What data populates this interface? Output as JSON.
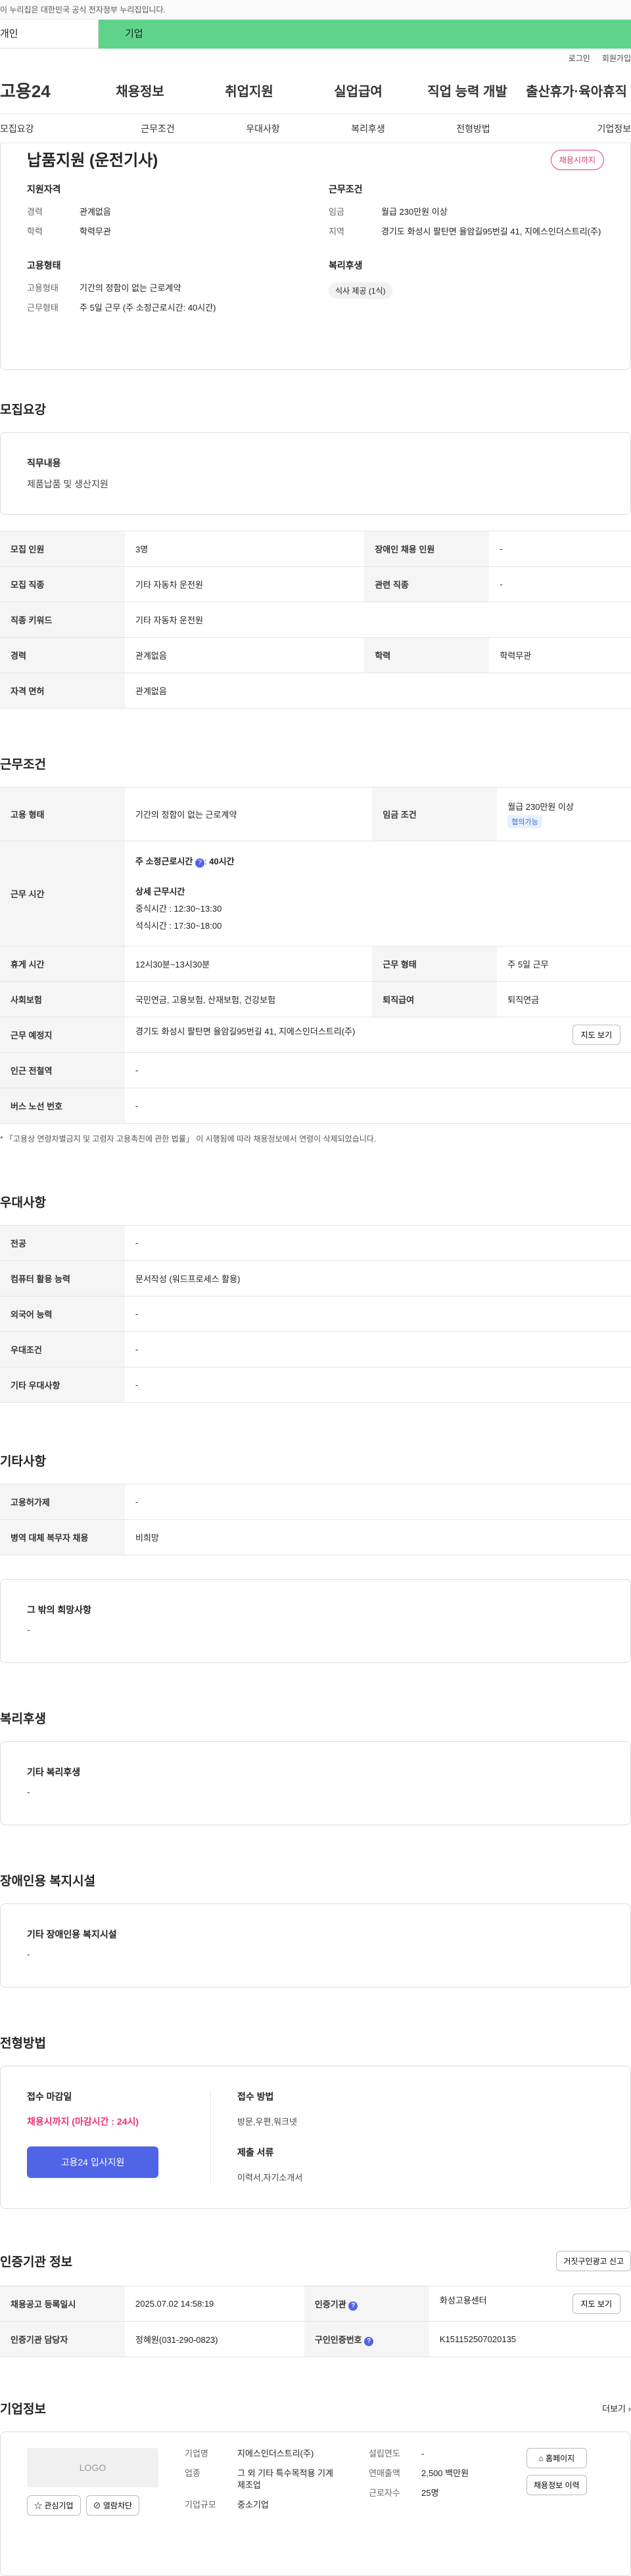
{
  "banner": "이 누리집은 대한민국 공식 전자정부 누리집입니다.",
  "typebar": {
    "personal": "개인",
    "corp": "기업"
  },
  "util": {
    "login": "로그인",
    "join": "회원가입"
  },
  "gnb": {
    "logo": "고용24",
    "items": [
      "채용정보",
      "취업지원",
      "실업급여",
      "직업 능력 개발",
      "출산휴가·육아휴직"
    ]
  },
  "tabs": [
    "모집요강",
    "근무조건",
    "우대사항",
    "복리후생",
    "전형방법",
    "기업정보"
  ],
  "summary": {
    "title": "납품지원 (운전기사)",
    "badge": "채용시까지",
    "qual_title": "지원자격",
    "career_k": "경력",
    "career_v": "관계없음",
    "edu_k": "학력",
    "edu_v": "학력무관",
    "cond_title": "근무조건",
    "wage_k": "임금",
    "wage_v": "월급 230만원 이상",
    "area_k": "지역",
    "area_v": "경기도 화성시 팔탄면 율암길95번길 41, 지에스인더스트리(주)",
    "emp_title": "고용형태",
    "etype_k": "고용형태",
    "etype_v": "기간의 정함이 없는 근로계약",
    "ework_k": "근무형태",
    "ework_v": "주 5일 근무 (주 소정근로시간: 40시간)",
    "welfare_title": "복리후생",
    "welfare_chip": "식사 제공 (1식)"
  },
  "recruit": {
    "title": "모집요강",
    "duty_h": "직무내용",
    "duty_v": "제품납품 및 생산지원",
    "rows": {
      "count_k": "모집 인원",
      "count_v": "3명",
      "dis_k": "장애인 채용 인원",
      "dis_v": "-",
      "job_k": "모집 직종",
      "job_v": "기타 자동차 운전원",
      "rel_k": "관련 직종",
      "rel_v": "-",
      "kw_k": "직종 키워드",
      "kw_v": "기타 자동차 운전원",
      "car_k": "경력",
      "car_v": "관계없음",
      "edu_k": "학력",
      "edu_v": "학력무관",
      "lic_k": "자격 면허",
      "lic_v": "관계없음"
    }
  },
  "work": {
    "title": "근무조건",
    "etype_k": "고용 형태",
    "etype_v": "기간의 정함이 없는 근로계약",
    "wage_k": "임금 조건",
    "wage_v": "월급 230만원 이상",
    "wage_badge": "협의가능",
    "time_k": "근무 시간",
    "time_v": "주 소정근로시간",
    "time_h": "40시간",
    "detail_h": "상세 근무시간",
    "lunch": "중식시간 : 12:30~13:30",
    "dinner": "석식시간 : 17:30~18:00",
    "rest_k": "휴게 시간",
    "rest_v": "12시30분~13시30분",
    "form_k": "근무 형태",
    "form_v": "주 5일 근무",
    "ins_k": "사회보험",
    "ins_v": "국민연금, 고용보험, 산재보험, 건강보험",
    "ret_k": "퇴직급여",
    "ret_v": "퇴직연금",
    "place_k": "근무 예정지",
    "place_v": "경기도 화성시 팔탄면 율암길95번길 41, 지에스인더스트리(주)",
    "map_btn": "지도 보기",
    "sub_k": "인근 전철역",
    "sub_v": "-",
    "bus_k": "버스 노선 번호",
    "bus_v": "-",
    "note": "* 「고용상 연령차별금지 및 고령자 고용촉진에 관한 법률」 이 시행됨에 따라 채용정보에서 연령이 삭제되었습니다."
  },
  "pref": {
    "title": "우대사항",
    "major_k": "전공",
    "major_v": "-",
    "pc_k": "컴퓨터 활용 능력",
    "pc_v": "문서작성 (워드프로세스 활용)",
    "lang_k": "외국어 능력",
    "lang_v": "-",
    "cond_k": "우대조건",
    "cond_v": "-",
    "etc_k": "기타 우대사항",
    "etc_v": "-"
  },
  "etc": {
    "title": "기타사항",
    "hire_k": "고용허가제",
    "hire_v": "-",
    "mil_k": "병역 대체 복무자 채용",
    "mil_v": "비희망",
    "other_h": "그 밖의 희망사항",
    "other_v": "-"
  },
  "benefit": {
    "title": "복리후생",
    "h": "기타 복리후생",
    "v": "-"
  },
  "disab": {
    "title": "장애인용 복지시설",
    "h": "기타 장애인용 복지시설",
    "v": "-"
  },
  "select": {
    "title": "전형방법",
    "deadline_h": "접수 마감일",
    "deadline_v": "채용시까지 (마감시간 : 24시)",
    "apply": "고용24 입사지원",
    "method_h": "접수 방법",
    "method_v": "방문,우편,워크넷",
    "docs_h": "제출 서류",
    "docs_v": "이력서,자기소개서"
  },
  "cert": {
    "title": "인증기관 정보",
    "report": "거짓구인광고 신고",
    "reg_k": "채용공고 등록일시",
    "reg_v": "2025.07.02 14:58:19",
    "org_k": "인증기관",
    "org_v": "화성고용센터",
    "map_btn": "지도 보기",
    "mgr_k": "인증기관 담당자",
    "mgr_v": "정혜원(031-290-0823)",
    "num_k": "구인인증번호",
    "num_v": "K151152507020135"
  },
  "corp": {
    "title": "기업정보",
    "more": "더보기",
    "logo": "LOGO",
    "fav": "관심기업",
    "block": "열람차단",
    "name_k": "기업명",
    "name_v": "지에스인더스트리(주)",
    "found_k": "설립연도",
    "found_v": "-",
    "ind_k": "업종",
    "ind_v": "그 외 기타 특수목적용 기계 제조업",
    "sales_k": "연매출액",
    "sales_v": "2,500 백만원",
    "staff_k": "근로자수",
    "staff_v": "25명",
    "size_k": "기업규모",
    "size_v": "중소기업",
    "home": "홈페이지",
    "history": "채용정보 이력"
  }
}
